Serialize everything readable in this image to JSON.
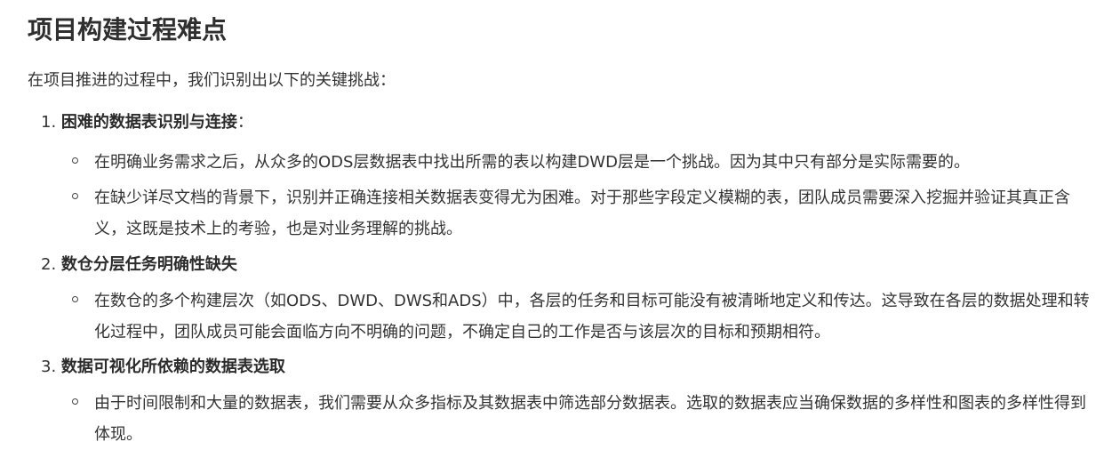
{
  "title": "项目构建过程难点",
  "intro": "在项目推进的过程中，我们识别出以下的关键挑战：",
  "items": [
    {
      "number": "1.",
      "heading": "困难的数据表识别与连接",
      "suffix": "：",
      "bullets": [
        "在明确业务需求之后，从众多的ODS层数据表中找出所需的表以构建DWD层是一个挑战。因为其中只有部分是实际需要的。",
        "在缺少详尽文档的背景下，识别并正确连接相关数据表变得尤为困难。对于那些字段定义模糊的表，团队成员需要深入挖掘并验证其真正含义，这既是技术上的考验，也是对业务理解的挑战。"
      ]
    },
    {
      "number": "2.",
      "heading": "数仓分层任务明确性缺失",
      "suffix": "",
      "bullets": [
        "在数仓的多个构建层次（如ODS、DWD、DWS和ADS）中，各层的任务和目标可能没有被清晰地定义和传达。这导致在各层的数据处理和转化过程中，团队成员可能会面临方向不明确的问题，不确定自己的工作是否与该层次的目标和预期相符。"
      ]
    },
    {
      "number": "3.",
      "heading": "数据可视化所依赖的数据表选取",
      "suffix": "",
      "bullets": [
        "由于时间限制和大量的数据表，我们需要从众多指标及其数据表中筛选部分数据表。选取的数据表应当确保数据的多样性和图表的多样性得到体现。"
      ]
    }
  ]
}
